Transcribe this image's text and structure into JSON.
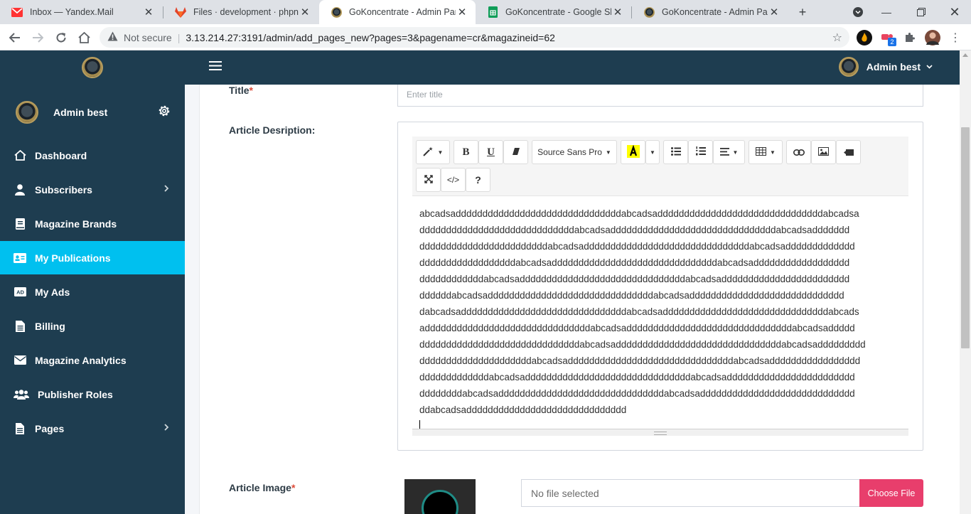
{
  "browser": {
    "tabs": [
      {
        "title": "Inbox — Yandex.Mail",
        "icon": "yandex-mail-icon",
        "active": false
      },
      {
        "title": "Files · development · phpnode",
        "icon": "gitlab-icon",
        "active": false
      },
      {
        "title": "GoKoncentrate - Admin Panel",
        "icon": "gokoncentrate-icon",
        "active": true
      },
      {
        "title": "GoKoncentrate - Google Sheets",
        "icon": "google-sheets-icon",
        "active": false
      },
      {
        "title": "GoKoncentrate - Admin Panel",
        "icon": "gokoncentrate-icon",
        "active": false
      }
    ],
    "new_tab": "+",
    "security_label": "Not secure",
    "url": "3.13.214.27:3191/admin/add_pages_new?pages=3&pagename=cr&magazineid=62",
    "extension_badge": "2",
    "colors": {
      "tabbar": "#dee1e6",
      "omnibox": "#f1f3f4"
    }
  },
  "header": {
    "user_name": "Admin best",
    "color": "#1e3d50"
  },
  "sidebar": {
    "user_name": "Admin best",
    "active_color": "#00c0ef",
    "items": [
      {
        "label": "Dashboard",
        "icon": "home-icon",
        "has_submenu": false,
        "active": false
      },
      {
        "label": "Subscribers",
        "icon": "user-icon",
        "has_submenu": true,
        "active": false
      },
      {
        "label": "Magazine Brands",
        "icon": "book-icon",
        "has_submenu": false,
        "active": false
      },
      {
        "label": "My Publications",
        "icon": "id-card-icon",
        "has_submenu": false,
        "active": true
      },
      {
        "label": "My Ads",
        "icon": "ad-icon",
        "has_submenu": false,
        "active": false
      },
      {
        "label": "Billing",
        "icon": "document-icon",
        "has_submenu": false,
        "active": false
      },
      {
        "label": "Magazine Analytics",
        "icon": "envelope-icon",
        "has_submenu": false,
        "active": false
      },
      {
        "label": "Publisher Roles",
        "icon": "users-icon",
        "has_submenu": false,
        "active": false
      },
      {
        "label": "Pages",
        "icon": "file-icon",
        "has_submenu": true,
        "active": false
      }
    ]
  },
  "form": {
    "title_label": "Title",
    "required_mark": "*",
    "title_placeholder": "Enter title",
    "description_label": "Article Desription:",
    "image_label": "Article Image",
    "file_status": "No file selected",
    "choose_file_label": "Choose File",
    "choose_file_color": "#e83e6c"
  },
  "editor": {
    "font_name": "Source Sans Pro",
    "bold": "B",
    "underline": "U",
    "help": "?",
    "code": "</>",
    "ad_icon_text": "AD",
    "lines": [
      "abcadsadddddddddddddddddddddddddddddddabcadsadddddddddddddddddddddddddddddddabcadsa",
      "dddddddddddddddddddddddddddddabcadsadddddddddddddddddddddddddddddddabcadsaddddddd",
      "ddddddddddddddddddddddddabcadsadddddddddddddddddddddddddddddddabcadsaddddddddddddd",
      "ddddddddddddddddddabcadsadddddddddddddddddddddddddddddddabcadsadddddddddddddddddd",
      "ddddddddddddabcadsadddddddddddddddddddddddddddddddabcadsadddddddddddddddddddddddd",
      "ddddddabcadsadddddddddddddddddddddddddddddddabcadsaddddddddddddddddddddddddddddd",
      "dabcadsadddddddddddddddddddddddddddddddabcadsadddddddddddddddddddddddddddddddabcads",
      "adddddddddddddddddddddddddddddddabcadsadddddddddddddddddddddddddddddddabcadsaddddd",
      "ddddddddddddddddddddddddddddddabcadsadddddddddddddddddddddddddddddddabcadsaddddddddd",
      "dddddddddddddddddddddabcadsadddddddddddddddddddddddddddddddabcadsaddddddddddddddddd",
      "dddddddddddddabcadsadddddddddddddddddddddddddddddddabcadsadddddddddddddddddddddddd",
      "ddddddddabcadsadddddddddddddddddddddddddddddddabcadsaddddddddddddddddddddddddddddd",
      "ddabcadsadddddddddddddddddddddddddddddd"
    ]
  }
}
